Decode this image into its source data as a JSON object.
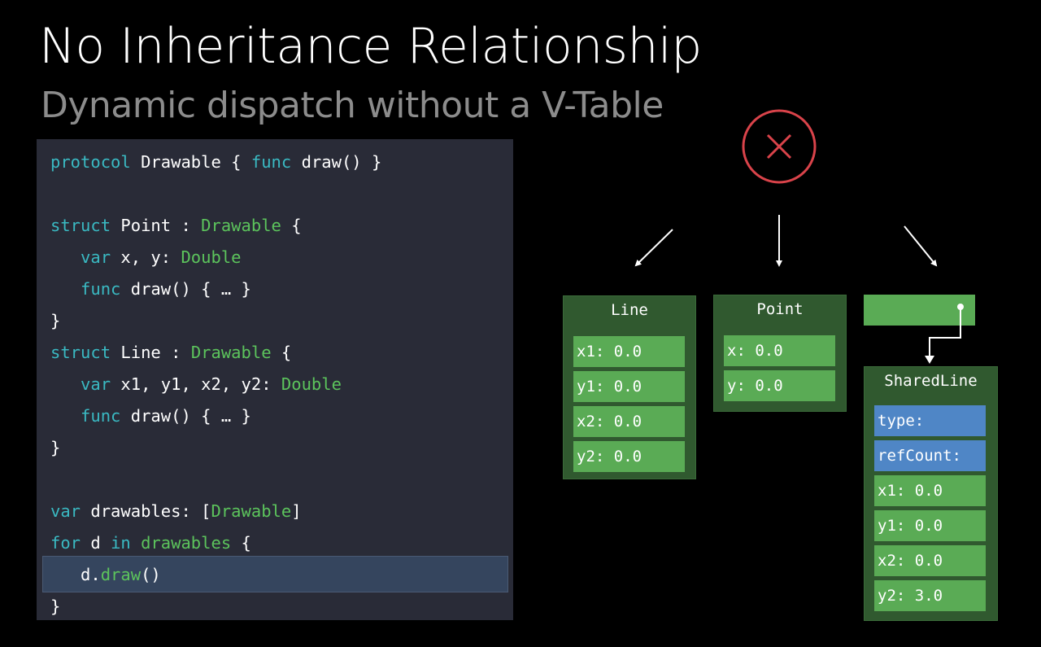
{
  "slide": {
    "title": "No Inheritance Relationship",
    "subtitle": "Dynamic dispatch without a V-Table"
  },
  "code": {
    "lines": [
      [
        [
          "protocol ",
          "kw"
        ],
        [
          "Drawable { ",
          "pl"
        ],
        [
          "func ",
          "kw"
        ],
        [
          "draw() }",
          "pl"
        ]
      ],
      [],
      [
        [
          "struct ",
          "kw"
        ],
        [
          "Point : ",
          "pl"
        ],
        [
          "Drawable ",
          "ty"
        ],
        [
          "{",
          "pl"
        ]
      ],
      [
        [
          "   var ",
          "kw"
        ],
        [
          "x, y: ",
          "pl"
        ],
        [
          "Double",
          "ty"
        ]
      ],
      [
        [
          "   func ",
          "kw"
        ],
        [
          "draw() { … }",
          "pl"
        ]
      ],
      [
        [
          "}",
          "pl"
        ]
      ],
      [
        [
          "struct ",
          "kw"
        ],
        [
          "Line : ",
          "pl"
        ],
        [
          "Drawable ",
          "ty"
        ],
        [
          "{",
          "pl"
        ]
      ],
      [
        [
          "   var ",
          "kw"
        ],
        [
          "x1, y1, x2, y2: ",
          "pl"
        ],
        [
          "Double",
          "ty"
        ]
      ],
      [
        [
          "   func ",
          "kw"
        ],
        [
          "draw() { … }",
          "pl"
        ]
      ],
      [
        [
          "}",
          "pl"
        ]
      ],
      [],
      [
        [
          "var ",
          "kw"
        ],
        [
          "drawables: [",
          "pl"
        ],
        [
          "Drawable",
          "ty"
        ],
        [
          "]",
          "pl"
        ]
      ],
      [
        [
          "for ",
          "kw"
        ],
        [
          "d ",
          "pl"
        ],
        [
          "in ",
          "kw"
        ],
        [
          "drawables ",
          "ty"
        ],
        [
          "{",
          "pl"
        ]
      ],
      [
        [
          "   d.",
          "pl"
        ],
        [
          "draw",
          "ty"
        ],
        [
          "()",
          "pl"
        ]
      ],
      [
        [
          "}",
          "pl"
        ]
      ]
    ],
    "highlighted_line": 13
  },
  "diagram": {
    "line_box": {
      "title": "Line",
      "fields": [
        "x1: 0.0",
        "y1: 0.0",
        "x2: 0.0",
        "y2: 0.0"
      ]
    },
    "point_box": {
      "title": "Point",
      "fields": [
        "x: 0.0",
        "y: 0.0"
      ]
    },
    "shared_line_box": {
      "title": "SharedLine",
      "header_fields": [
        "type:",
        "refCount:"
      ],
      "fields": [
        "x1: 0.0",
        "y1: 0.0",
        "x2: 0.0",
        "y2: 3.0"
      ]
    },
    "colors": {
      "dark_green": "#30592f",
      "light_green": "#5aab55",
      "blue": "#4f86c6",
      "red": "#d9434a",
      "code_bg": "#292b37",
      "keyword": "#3ab9c2",
      "type": "#5cc45c"
    }
  }
}
